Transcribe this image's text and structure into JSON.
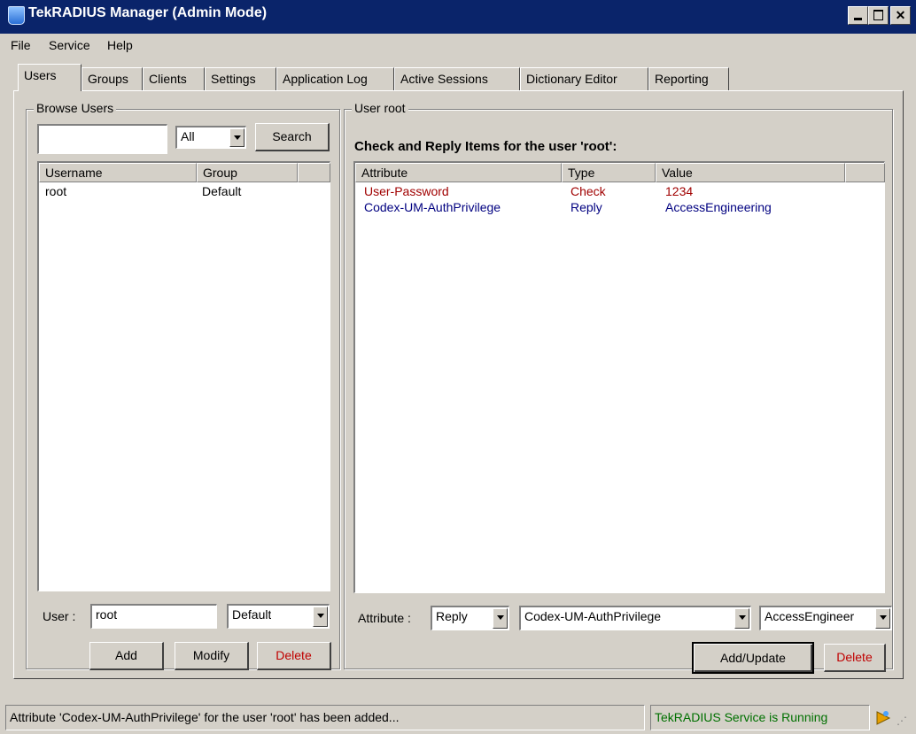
{
  "window": {
    "title": "TekRADIUS Manager (Admin Mode)"
  },
  "menu": [
    "File",
    "Service",
    "Help"
  ],
  "tabs": [
    "Users",
    "Groups",
    "Clients",
    "Settings",
    "Application Log",
    "Active Sessions",
    "Dictionary Editor",
    "Reporting"
  ],
  "browse": {
    "legend": "Browse Users",
    "search_value": "",
    "filter_value": "All",
    "search_label": "Search",
    "columns": [
      "Username",
      "Group"
    ],
    "rows": [
      {
        "username": "root",
        "group": "Default"
      }
    ],
    "user_label": "User :",
    "user_value": "root",
    "group_value": "Default",
    "add_label": "Add",
    "modify_label": "Modify",
    "delete_label": "Delete"
  },
  "user_panel": {
    "legend": "User root",
    "heading": "Check and Reply Items for the user 'root':",
    "columns": [
      "Attribute",
      "Type",
      "Value"
    ],
    "rows": [
      {
        "attribute": "User-Password",
        "type": "Check",
        "value": "1234",
        "color": "#a00000"
      },
      {
        "attribute": "Codex-UM-AuthPrivilege",
        "type": "Reply",
        "value": "AccessEngineering",
        "color": "#000080"
      }
    ],
    "attribute_label": "Attribute :",
    "type_value": "Reply",
    "attr_value": "Codex-UM-AuthPrivilege",
    "value_value": "AccessEngineer",
    "add_update_label": "Add/Update",
    "delete_label": "Delete"
  },
  "status": {
    "message": "Attribute 'Codex-UM-AuthPrivilege' for the user 'root' has been added...",
    "service": "TekRADIUS Service is Running",
    "service_color": "#007000"
  }
}
